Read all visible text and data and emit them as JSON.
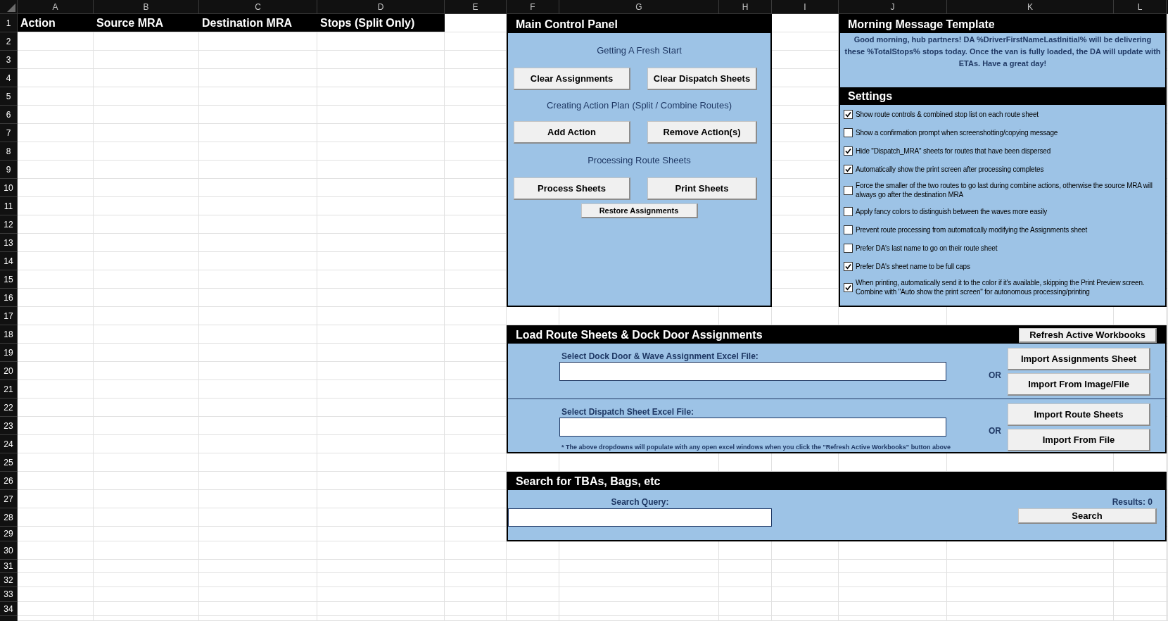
{
  "sheet": {
    "columns": [
      "A",
      "B",
      "C",
      "D",
      "E",
      "F",
      "G",
      "H",
      "I",
      "J",
      "K",
      "L"
    ],
    "rows": [
      "1",
      "2",
      "3",
      "4",
      "5",
      "6",
      "7",
      "8",
      "9",
      "10",
      "11",
      "12",
      "13",
      "14",
      "15",
      "16",
      "17",
      "18",
      "19",
      "20",
      "21",
      "22",
      "23",
      "24",
      "25",
      "26",
      "27",
      "28",
      "29",
      "30",
      "31",
      "32",
      "33",
      "34"
    ]
  },
  "assignments_table": {
    "columns": [
      "Action",
      "Source MRA",
      "Destination MRA",
      "Stops (Split Only)"
    ]
  },
  "main_control_panel": {
    "title": "Main Control Panel",
    "sections": [
      {
        "heading": "Getting A Fresh Start",
        "buttons": [
          "Clear Assignments",
          "Clear Dispatch Sheets"
        ]
      },
      {
        "heading": "Creating Action Plan (Split / Combine Routes)",
        "buttons": [
          "Add Action",
          "Remove Action(s)"
        ]
      },
      {
        "heading": "Processing Route Sheets",
        "buttons": [
          "Process Sheets",
          "Print Sheets"
        ]
      }
    ],
    "restore_button": "Restore Assignments"
  },
  "morning_message": {
    "title": "Morning Message Template",
    "text": "Good morning, hub partners! DA %DriverFirstNameLastInitial% will be delivering these %TotalStops% stops today. Once the van is fully loaded, the DA will update with ETAs. Have a great day!"
  },
  "settings": {
    "title": "Settings",
    "items": [
      {
        "label": "Show route controls & combined stop list on each route sheet",
        "checked": true
      },
      {
        "label": "Show a confirmation prompt when screenshotting/copying message",
        "checked": false
      },
      {
        "label": "Hide \"Dispatch_MRA\" sheets for routes that have been dispersed",
        "checked": true
      },
      {
        "label": "Automatically show the print screen after processing completes",
        "checked": true
      },
      {
        "label": "Force the smaller of the two routes to go last during combine actions, otherwise the source MRA will always go after the destination MRA",
        "checked": false
      },
      {
        "label": "Apply fancy colors to distinguish between the waves more easily",
        "checked": false
      },
      {
        "label": "Prevent route processing from automatically modifying the Assignments sheet",
        "checked": false
      },
      {
        "label": "Prefer DA's last name to go on their route sheet",
        "checked": false
      },
      {
        "label": "Prefer DA's sheet name to be full caps",
        "checked": true
      },
      {
        "label": "When printing, automatically send it to the color if it's available, skipping the Print Preview screen. Combine with \"Auto show the print screen\" for autonomous processing/printing",
        "checked": true
      }
    ]
  },
  "load_route_sheets": {
    "title": "Load Route Sheets & Dock Door Assignments",
    "refresh_button": "Refresh Active Workbooks",
    "file_pickers": [
      {
        "label": "Select Dock Door & Wave Assignment Excel File:",
        "separator": "OR",
        "buttons": [
          "Import Assignments Sheet",
          "Import From Image/File"
        ]
      },
      {
        "label": "Select Dispatch Sheet Excel File:",
        "separator": "OR",
        "buttons": [
          "Import Route Sheets",
          "Import From File"
        ],
        "note": "* The above dropdowns will populate with any open excel windows when you click the \"Refresh Active Workbooks\" button above"
      }
    ]
  },
  "search": {
    "title": "Search for TBAs, Bags, etc",
    "query_label": "Search Query:",
    "results": "Results: 0",
    "button": "Search"
  }
}
